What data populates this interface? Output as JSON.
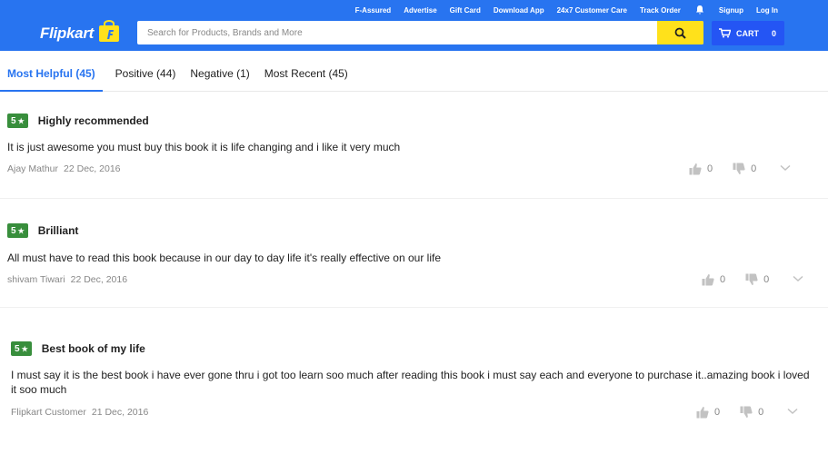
{
  "header": {
    "links": [
      "F-Assured",
      "Advertise",
      "Gift Card",
      "Download App",
      "24x7 Customer Care",
      "Track Order"
    ],
    "signup": "Signup",
    "login": "Log In",
    "logo": "Flipkart",
    "search_placeholder": "Search for Products, Brands and More",
    "cart_label": "CART",
    "cart_count": "0"
  },
  "tabs": [
    {
      "label": "Most Helpful (45)",
      "active": true
    },
    {
      "label": "Positive (44)"
    },
    {
      "label": "Negative (1)"
    },
    {
      "label": "Most Recent (45)"
    }
  ],
  "reviews": [
    {
      "rating": "5",
      "title": "Highly recommended",
      "text": "It is just awesome you must buy this book it is life changing and i like it very much",
      "author": "Ajay Mathur",
      "date": "22 Dec, 2016",
      "up": "0",
      "down": "0"
    },
    {
      "rating": "5",
      "title": "Brilliant",
      "text": "All must have to read this book because in our day to day life it's really effective on our life",
      "author": "shivam Tiwari",
      "date": "22 Dec, 2016",
      "up": "0",
      "down": "0"
    },
    {
      "rating": "5",
      "title": "Best book of my life",
      "text": "I must say it is the best book i have ever gone thru i got too learn soo much after reading this book i must say each and everyone to purchase it..amazing book i loved it soo much",
      "author": "Flipkart Customer",
      "date": "21 Dec, 2016",
      "up": "0",
      "down": "0"
    }
  ],
  "colors": {
    "brand": "#2874f0",
    "search_button": "#ffe11b",
    "rating": "#388e3c"
  }
}
